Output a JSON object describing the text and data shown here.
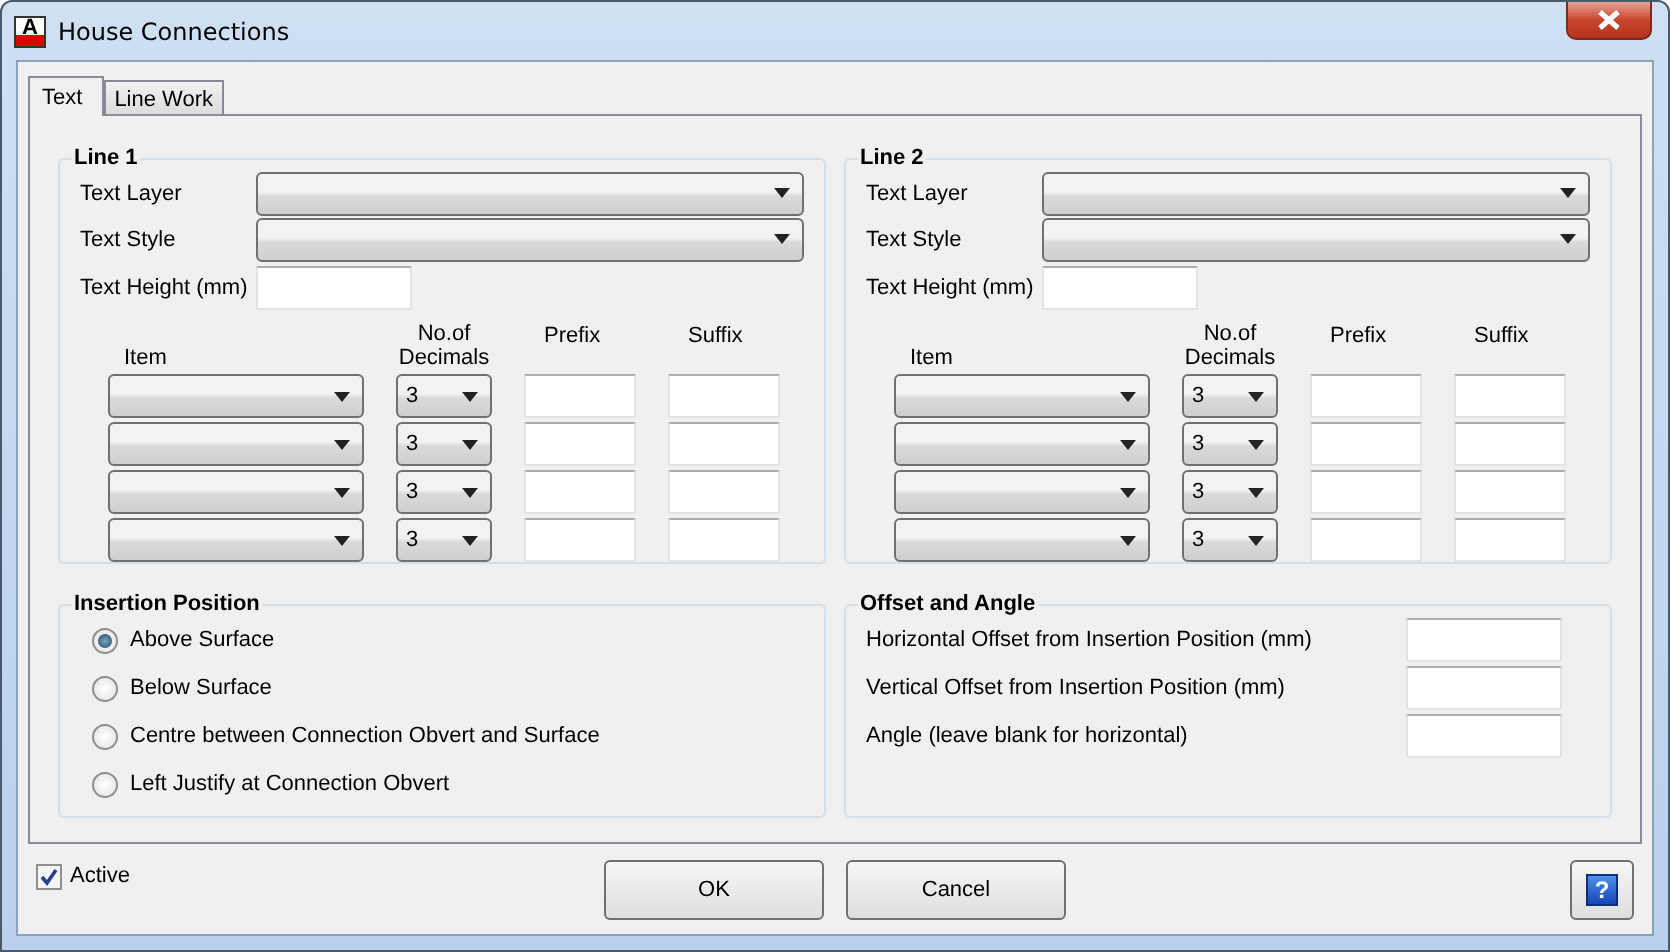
{
  "window": {
    "title": "House Connections",
    "icon_letter": "A"
  },
  "tabs": [
    {
      "label": "Text",
      "selected": true
    },
    {
      "label": "Line Work",
      "selected": false
    }
  ],
  "line_groups": [
    {
      "title": "Line 1",
      "text_layer_label": "Text Layer",
      "text_style_label": "Text Style",
      "text_height_label": "Text Height (mm)",
      "columns": [
        "Item",
        "No.of Decimals",
        "Prefix",
        "Suffix"
      ],
      "rows": [
        {
          "decimals": "3"
        },
        {
          "decimals": "3"
        },
        {
          "decimals": "3"
        },
        {
          "decimals": "3"
        }
      ]
    },
    {
      "title": "Line 2",
      "text_layer_label": "Text Layer",
      "text_style_label": "Text Style",
      "text_height_label": "Text Height (mm)",
      "columns": [
        "Item",
        "No.of Decimals",
        "Prefix",
        "Suffix"
      ],
      "rows": [
        {
          "decimals": "3"
        },
        {
          "decimals": "3"
        },
        {
          "decimals": "3"
        },
        {
          "decimals": "3"
        }
      ]
    }
  ],
  "insertion_position": {
    "title": "Insertion Position",
    "options": [
      {
        "label": "Above Surface",
        "selected": true
      },
      {
        "label": "Below Surface",
        "selected": false
      },
      {
        "label": "Centre between Connection Obvert and Surface",
        "selected": false
      },
      {
        "label": "Left Justify at Connection Obvert",
        "selected": false
      }
    ]
  },
  "offset_and_angle": {
    "title": "Offset and Angle",
    "fields": [
      {
        "label": "Horizontal Offset from Insertion Position (mm)"
      },
      {
        "label": "Vertical Offset from Insertion Position (mm)"
      },
      {
        "label": "Angle (leave blank for horizontal)"
      }
    ]
  },
  "active": {
    "label": "Active",
    "checked": true
  },
  "buttons": [
    "OK",
    "Cancel"
  ],
  "help_button": {
    "symbol": "?"
  }
}
